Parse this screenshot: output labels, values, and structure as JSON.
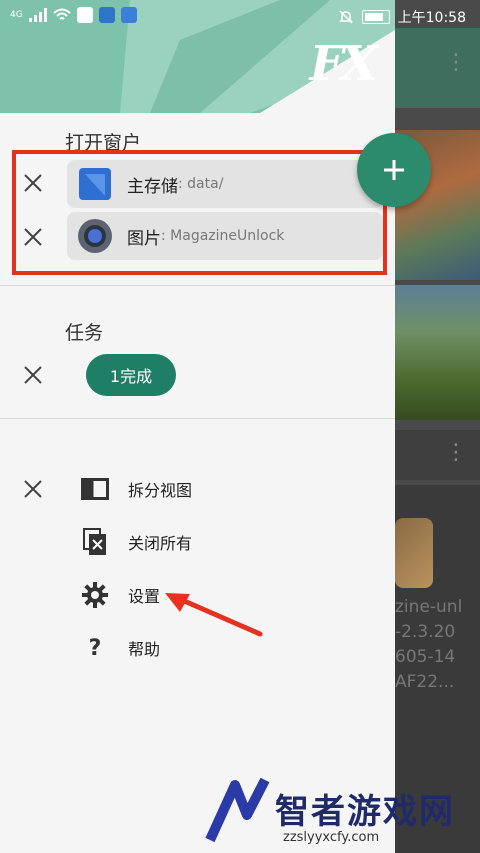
{
  "status_bar": {
    "network": "4G",
    "time": "上午10:58"
  },
  "app": {
    "logo": "FX"
  },
  "open_windows": {
    "title": "打开窗户",
    "items": [
      {
        "name": "主存储",
        "path": ": data/"
      },
      {
        "name": "图片",
        "path": ": MagazineUnlock"
      }
    ]
  },
  "tasks": {
    "title": "任务",
    "done_button": "1完成"
  },
  "menu": {
    "split_view": "拆分视图",
    "close_all": "关闭所有",
    "settings": "设置",
    "help": "帮助"
  },
  "background": {
    "file_text": "zine-unl\n-2.3.20\n605-14\nAF22..."
  },
  "watermark": {
    "title": "智者游戏网",
    "url": "zzslyyxcfy.com"
  },
  "colors": {
    "accent": "#1e7f66",
    "header": "#7dc3ac",
    "annotation": "#e5321e"
  }
}
